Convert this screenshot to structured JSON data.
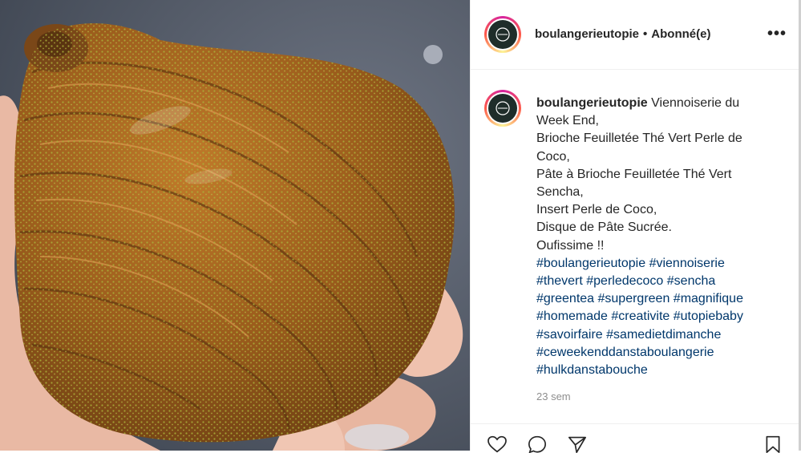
{
  "post": {
    "image_alt": "Brioche feuilletée au thé vert",
    "username": "boulangerieutopie",
    "separator": "•",
    "follow_status": "Abonné(e)",
    "more_label": "•••",
    "caption_lines": [
      "Viennoiserie du",
      "Week End,",
      "Brioche Feuilletée Thé Vert Perle de",
      "Coco,",
      "Pâte à Brioche Feuilletée Thé Vert",
      "Sencha,",
      "Insert Perle de Coco,",
      "Disque de Pâte Sucrée.",
      "Oufissime !!"
    ],
    "hashtag_lines": [
      "#boulangerieutopie #viennoiserie",
      "#thevert #perledecoco #sencha",
      "#greentea #supergreen #magnifique",
      "#homemade #creativite #utopiebaby",
      "#savoirfaire #samedietdimanche",
      "#ceweekenddanstaboulangerie",
      "#hulkdanstabouche"
    ],
    "time_ago": "23 sem"
  },
  "actions": {
    "icons": [
      "heart-icon",
      "comment-icon",
      "share-icon",
      "bookmark-icon"
    ]
  },
  "colors": {
    "text": "#262626",
    "hashtag": "#00376b",
    "muted": "#8e8e8e",
    "border": "#efefef"
  }
}
